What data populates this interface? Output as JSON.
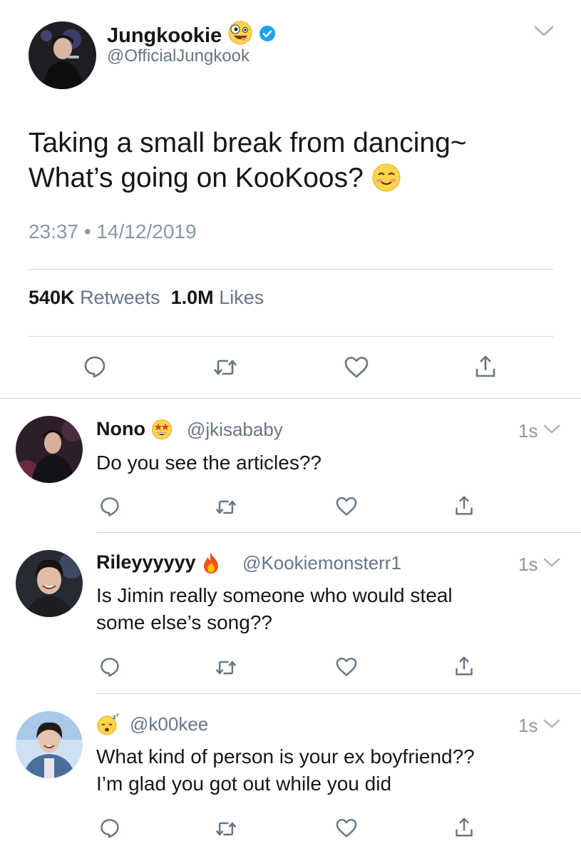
{
  "main_tweet": {
    "author_name": "Jungkookie",
    "author_handle": "@OfficialJungkook",
    "text_lines": [
      "Taking a small break from dancing~",
      "What’s going on KooKoos?"
    ],
    "timestamp": "23:37 • 14/12/2019",
    "retweet_count": "540K",
    "retweet_label": "Retweets",
    "like_count": "1.0M",
    "like_label": "Likes",
    "emoji_name": "zany-face",
    "text_emoji": "smiling-face"
  },
  "replies": [
    {
      "name": "Nono",
      "name_emoji": "star-struck",
      "handle": "@jkisababy",
      "time": "1s",
      "text_lines": [
        "Do you see the articles??"
      ]
    },
    {
      "name": "Rileyyyyyy",
      "name_emoji": "fire",
      "handle": "@Kookiemonsterr1",
      "time": "1s",
      "text_lines": [
        "Is Jimin really someone who would steal",
        "some else’s song??"
      ]
    },
    {
      "name": "",
      "name_emoji": "sleeping-face",
      "handle": "@k00kee",
      "time": "1s",
      "text_lines": [
        "What kind of person is your ex boyfriend??",
        "I’m glad you got out while you did"
      ]
    }
  ],
  "icons": [
    "reply-icon",
    "retweet-icon",
    "like-icon",
    "share-icon",
    "chevron-down-icon",
    "verified-icon"
  ],
  "colors": {
    "text": "#14171a",
    "secondary": "#657786",
    "light": "#8899a6",
    "divider": "#ccd6dd",
    "verified": "#1da1f2",
    "icon": "#657786"
  }
}
